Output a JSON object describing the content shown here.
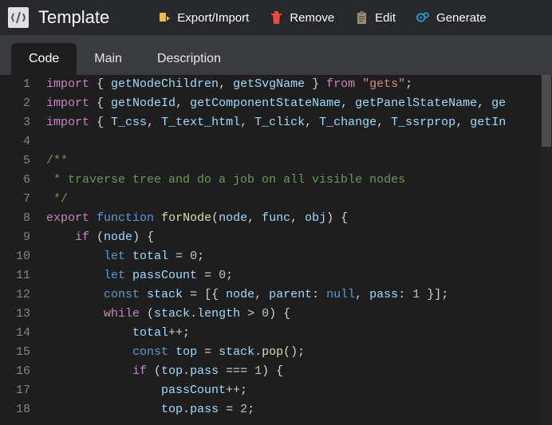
{
  "header": {
    "title": "Template",
    "actions": [
      {
        "label": "Export/Import",
        "icon": "export-icon",
        "color": "#f0b84a"
      },
      {
        "label": "Remove",
        "icon": "trash-icon",
        "color": "#e74c3c"
      },
      {
        "label": "Edit",
        "icon": "clipboard-icon",
        "color": "#9a8f7a"
      },
      {
        "label": "Generate",
        "icon": "gears-icon",
        "color": "#2aa0d0"
      }
    ]
  },
  "tabs": [
    {
      "label": "Code",
      "active": true
    },
    {
      "label": "Main",
      "active": false
    },
    {
      "label": "Description",
      "active": false
    }
  ],
  "editor": {
    "first_line": 1,
    "last_line": 18,
    "lines": [
      [
        [
          "kw",
          "import"
        ],
        [
          "pn",
          " { "
        ],
        [
          "var",
          "getNodeChildren"
        ],
        [
          "pn",
          ", "
        ],
        [
          "var",
          "getSvgName"
        ],
        [
          "pn",
          " } "
        ],
        [
          "kw",
          "from"
        ],
        [
          "pn",
          " "
        ],
        [
          "str",
          "\"gets\""
        ],
        [
          "pn",
          ";"
        ]
      ],
      [
        [
          "kw",
          "import"
        ],
        [
          "pn",
          " { "
        ],
        [
          "var",
          "getNodeId"
        ],
        [
          "pn",
          ", "
        ],
        [
          "var",
          "getComponentStateName"
        ],
        [
          "pn",
          ", "
        ],
        [
          "var",
          "getPanelStateName"
        ],
        [
          "pn",
          ", "
        ],
        [
          "var",
          "ge"
        ]
      ],
      [
        [
          "kw",
          "import"
        ],
        [
          "pn",
          " { "
        ],
        [
          "var",
          "T_css"
        ],
        [
          "pn",
          ", "
        ],
        [
          "var",
          "T_text_html"
        ],
        [
          "pn",
          ", "
        ],
        [
          "var",
          "T_click"
        ],
        [
          "pn",
          ", "
        ],
        [
          "var",
          "T_change"
        ],
        [
          "pn",
          ", "
        ],
        [
          "var",
          "T_ssrprop"
        ],
        [
          "pn",
          ", "
        ],
        [
          "var",
          "getIn"
        ]
      ],
      [],
      [
        [
          "cmt",
          "/**"
        ]
      ],
      [
        [
          "cmt",
          " * traverse tree and do a job on all visible nodes"
        ]
      ],
      [
        [
          "cmt",
          " */"
        ]
      ],
      [
        [
          "kw",
          "export"
        ],
        [
          "pn",
          " "
        ],
        [
          "vkw",
          "function"
        ],
        [
          "pn",
          " "
        ],
        [
          "fn",
          "forNode"
        ],
        [
          "pn",
          "("
        ],
        [
          "var",
          "node"
        ],
        [
          "pn",
          ", "
        ],
        [
          "var",
          "func"
        ],
        [
          "pn",
          ", "
        ],
        [
          "var",
          "obj"
        ],
        [
          "pn",
          ") {"
        ]
      ],
      [
        [
          "pn",
          "    "
        ],
        [
          "kw",
          "if"
        ],
        [
          "pn",
          " ("
        ],
        [
          "var",
          "node"
        ],
        [
          "pn",
          ") {"
        ]
      ],
      [
        [
          "pn",
          "        "
        ],
        [
          "vkw",
          "let"
        ],
        [
          "pn",
          " "
        ],
        [
          "var",
          "total"
        ],
        [
          "pn",
          " = "
        ],
        [
          "num",
          "0"
        ],
        [
          "pn",
          ";"
        ]
      ],
      [
        [
          "pn",
          "        "
        ],
        [
          "vkw",
          "let"
        ],
        [
          "pn",
          " "
        ],
        [
          "var",
          "passCount"
        ],
        [
          "pn",
          " = "
        ],
        [
          "num",
          "0"
        ],
        [
          "pn",
          ";"
        ]
      ],
      [
        [
          "pn",
          "        "
        ],
        [
          "vkw",
          "const"
        ],
        [
          "pn",
          " "
        ],
        [
          "var",
          "stack"
        ],
        [
          "pn",
          " = [{ "
        ],
        [
          "var",
          "node"
        ],
        [
          "pn",
          ", "
        ],
        [
          "var",
          "parent"
        ],
        [
          "pn",
          ": "
        ],
        [
          "vkw",
          "null"
        ],
        [
          "pn",
          ", "
        ],
        [
          "var",
          "pass"
        ],
        [
          "pn",
          ": "
        ],
        [
          "num",
          "1"
        ],
        [
          "pn",
          " }];"
        ]
      ],
      [
        [
          "pn",
          "        "
        ],
        [
          "kw",
          "while"
        ],
        [
          "pn",
          " ("
        ],
        [
          "var",
          "stack"
        ],
        [
          "pn",
          "."
        ],
        [
          "var",
          "length"
        ],
        [
          "pn",
          " > "
        ],
        [
          "num",
          "0"
        ],
        [
          "pn",
          ") {"
        ]
      ],
      [
        [
          "pn",
          "            "
        ],
        [
          "var",
          "total"
        ],
        [
          "pn",
          "++;"
        ]
      ],
      [
        [
          "pn",
          "            "
        ],
        [
          "vkw",
          "const"
        ],
        [
          "pn",
          " "
        ],
        [
          "var",
          "top"
        ],
        [
          "pn",
          " = "
        ],
        [
          "var",
          "stack"
        ],
        [
          "pn",
          "."
        ],
        [
          "fn",
          "pop"
        ],
        [
          "pn",
          "();"
        ]
      ],
      [
        [
          "pn",
          "            "
        ],
        [
          "kw",
          "if"
        ],
        [
          "pn",
          " ("
        ],
        [
          "var",
          "top"
        ],
        [
          "pn",
          "."
        ],
        [
          "var",
          "pass"
        ],
        [
          "pn",
          " === "
        ],
        [
          "num",
          "1"
        ],
        [
          "pn",
          ") {"
        ]
      ],
      [
        [
          "pn",
          "                "
        ],
        [
          "var",
          "passCount"
        ],
        [
          "pn",
          "++;"
        ]
      ],
      [
        [
          "pn",
          "                "
        ],
        [
          "var",
          "top"
        ],
        [
          "pn",
          "."
        ],
        [
          "var",
          "pass"
        ],
        [
          "pn",
          " = "
        ],
        [
          "num",
          "2"
        ],
        [
          "pn",
          ";"
        ]
      ]
    ]
  }
}
